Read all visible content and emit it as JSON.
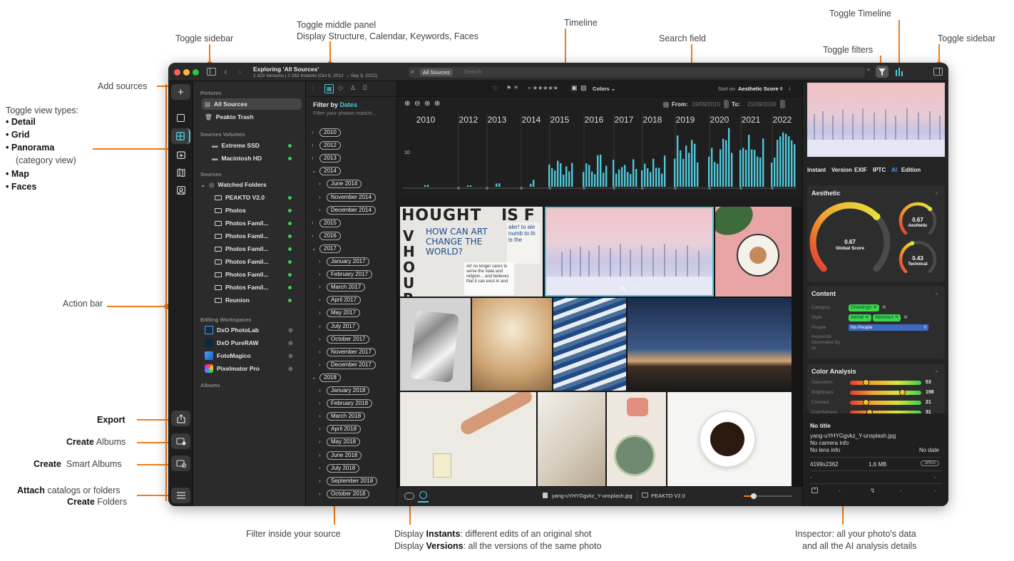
{
  "annotations": {
    "toggle_sidebar_left": "Toggle sidebar",
    "toggle_middle_panel_line1": "Toggle middle panel",
    "toggle_middle_panel_line2": "Display Structure, Calendar, Keywords, Faces",
    "timeline": "Timeline",
    "search_field": "Search field",
    "toggle_filters": "Toggle filters",
    "toggle_timeline": "Toggle Timeline",
    "toggle_sidebar_right": "Toggle sidebar",
    "add_sources": "Add sources",
    "toggle_view_types": "Toggle view types:",
    "view_types": [
      "Detail",
      "Grid",
      "Panorama",
      "Map",
      "Faces"
    ],
    "panorama_note": "(category view)",
    "action_bar": "Action bar",
    "export": "Export",
    "create_albums_bold": "Create",
    "create_albums_rest": "Albums",
    "create_smart_bold": "Create",
    "create_smart_rest": "Smart Albums",
    "attach_bold": "Attach",
    "attach_rest": "catalogs or folders",
    "create_folders_bold": "Create",
    "create_folders_rest": "Folders",
    "filter_inside": "Filter inside your source",
    "instants_pre": "Display",
    "instants_bold": "Instants",
    "instants_rest": ": different edits of an original shot",
    "versions_pre": "Display",
    "versions_bold": "Versions",
    "versions_rest": ": all the versions of the same photo",
    "inspector_line1": "Inspector: all your photo's data",
    "inspector_line2": "and all the AI analysis details"
  },
  "window": {
    "title": "Exploring 'All Sources'",
    "subtitle": "2 320 Versions | 2 282 Instants (Oct 8, 2012 → Sep 9, 2022)",
    "search_scope": "All Sources",
    "search_placeholder": "Search"
  },
  "sidebar": {
    "pictures_header": "Pictures",
    "all_sources": "All Sources",
    "trash": "Peakto Trash",
    "volumes_header": "Sources Volumes",
    "volumes": [
      "Extreme SSD",
      "Macintosh HD"
    ],
    "sources_header": "Sources",
    "watched": "Watched Folders",
    "folders": [
      "PEAKTO V2.0",
      "Photos",
      "Photos Famil...",
      "Photos Famil...",
      "Photos Famil...",
      "Photos Famil...",
      "Photos Famil...",
      "Photos Famil...",
      "Reunion"
    ],
    "workspaces_header": "Editing Workspaces",
    "workspaces": [
      "DxO PhotoLab",
      "DxO PureRAW",
      "FotoMagico",
      "Pixelmator Pro"
    ],
    "albums_header": "Albums"
  },
  "middle": {
    "filter_by": "Filter by",
    "filter_field": "Dates",
    "filter_hint": "Filter your photos matchi...",
    "items": [
      {
        "label": "2010",
        "level": 0,
        "open": false
      },
      {
        "label": "2012",
        "level": 0,
        "open": false
      },
      {
        "label": "2013",
        "level": 0,
        "open": false
      },
      {
        "label": "2014",
        "level": 0,
        "open": true
      },
      {
        "label": "June 2014",
        "level": 1,
        "open": false
      },
      {
        "label": "November 2014",
        "level": 1,
        "open": false
      },
      {
        "label": "December 2014",
        "level": 1,
        "open": false
      },
      {
        "label": "2015",
        "level": 0,
        "open": false
      },
      {
        "label": "2016",
        "level": 0,
        "open": false
      },
      {
        "label": "2017",
        "level": 0,
        "open": true
      },
      {
        "label": "January 2017",
        "level": 1,
        "open": false
      },
      {
        "label": "February 2017",
        "level": 1,
        "open": false
      },
      {
        "label": "March 2017",
        "level": 1,
        "open": false
      },
      {
        "label": "April 2017",
        "level": 1,
        "open": false
      },
      {
        "label": "May 2017",
        "level": 1,
        "open": false
      },
      {
        "label": "July 2017",
        "level": 1,
        "open": false
      },
      {
        "label": "October 2017",
        "level": 1,
        "open": false
      },
      {
        "label": "November 2017",
        "level": 1,
        "open": false
      },
      {
        "label": "December 2017",
        "level": 1,
        "open": false
      },
      {
        "label": "2018",
        "level": 0,
        "open": true
      },
      {
        "label": "January 2018",
        "level": 1,
        "open": false
      },
      {
        "label": "February 2018",
        "level": 1,
        "open": false
      },
      {
        "label": "March 2018",
        "level": 1,
        "open": false
      },
      {
        "label": "April 2018",
        "level": 1,
        "open": false
      },
      {
        "label": "May 2018",
        "level": 1,
        "open": false
      },
      {
        "label": "June 2018",
        "level": 1,
        "open": false
      },
      {
        "label": "July 2018",
        "level": 1,
        "open": false
      },
      {
        "label": "September 2018",
        "level": 1,
        "open": false
      },
      {
        "label": "October 2018",
        "level": 1,
        "open": false
      }
    ]
  },
  "toolbar": {
    "rating": "= ★★★★★",
    "colors": "Colors",
    "sort_on": "Sort on",
    "sort_value": "Aesthetic Score ◊"
  },
  "timeline": {
    "from_label": "From:",
    "from_value": "19/09/2015",
    "to_label": "To:",
    "to_value": "21/09/2018",
    "y_tick": "10",
    "years": [
      "2010",
      "2012",
      "2013",
      "2014",
      "2015",
      "2016",
      "2017",
      "2018",
      "2019",
      "2020",
      "2021",
      "2022"
    ]
  },
  "chart_data": {
    "type": "bar",
    "title": "",
    "xlabel": "",
    "ylabel": "",
    "categories": [
      "2010",
      "2012",
      "2013",
      "2014",
      "2015",
      "2016",
      "2017",
      "2018",
      "2019",
      "2020",
      "2021",
      "2022"
    ],
    "values": [
      1,
      1,
      2,
      3,
      12,
      13,
      11,
      13,
      22,
      24,
      23,
      22
    ]
  },
  "bottombar": {
    "filename": "yang-uYHYGgvkz_Y-unsplash.jpg",
    "folder": "PEAKTO V2.0"
  },
  "photo_texts": {
    "headline1": "HOUGHT",
    "headline2": "IS F",
    "question": "HOW CAN ART CHANGE THE WORLD?",
    "small_text": "Art no longer cares to serve the state and religion... and believes that it can exist in and",
    "left_letters": "V H OUR ACTION",
    "side_text": "aler! to ale numb to th is the"
  },
  "inspector": {
    "tabs": [
      "Instant",
      "Version",
      "EXIF",
      "IPTC",
      "AI",
      "Edition"
    ],
    "active_tab": "AI",
    "aesthetic_title": "Aesthetic",
    "global_score": "0.67",
    "global_label": "Global Score",
    "aesthetic_score": "0.67",
    "aesthetic_label": "Aesthetic",
    "technical_score": "0.43",
    "technical_label": "Technical",
    "global_value": 0.67,
    "aesthetic_value": 0.67,
    "technical_value": 0.43,
    "content_title": "Content",
    "category_label": "Category",
    "category_tags": [
      "Drawings"
    ],
    "style_label": "Style",
    "style_tags": [
      "Aerial",
      "Abstract"
    ],
    "people_label": "People",
    "people_value": "No People",
    "keywords_label": "Keywords Generated By AI",
    "color_title": "Color Analysis",
    "color_rows": [
      {
        "label": "Saturation",
        "value": "53",
        "pos": 0.2
      },
      {
        "label": "Brightness",
        "value": "198",
        "pos": 0.75
      },
      {
        "label": "Contrast",
        "value": "21",
        "pos": 0.2
      },
      {
        "label": "Colorfulness",
        "value": "31",
        "pos": 0.25
      }
    ],
    "no_title": "No title",
    "filename": "yang-uYHYGgvkz_Y-unsplash.jpg",
    "camera": "No camera info",
    "lens": "No lens info",
    "date": "No date",
    "dimensions": "4199x2362",
    "size": "1,6 MB",
    "format": "JPEG",
    "dash": "-"
  },
  "colors": {
    "accent": "#f07d1c",
    "bar": "#4fc7d9",
    "green": "#3fd44f",
    "blue": "#4a9eff"
  }
}
